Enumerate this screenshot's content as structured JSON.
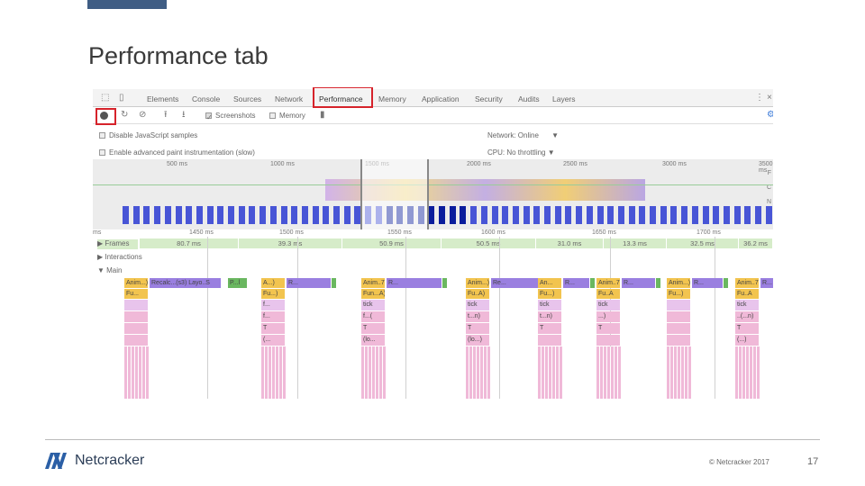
{
  "slide": {
    "title": "Performance tab",
    "copyright": "© Netcracker 2017",
    "page_number": "17",
    "logo_text": "Netcracker",
    "accent": "#3f5d84",
    "highlight": "#d6232b"
  },
  "devtools": {
    "tabs": [
      "Elements",
      "Console",
      "Sources",
      "Network",
      "Performance",
      "Memory",
      "Application",
      "Security",
      "Audits",
      "Layers"
    ],
    "active_tab": "Performance",
    "toolbar": {
      "screenshots_label": "Screenshots",
      "screenshots_checked": true,
      "memory_label": "Memory",
      "memory_checked": false
    },
    "settings": {
      "disable_js_samples": "Disable JavaScript samples",
      "advanced_paint": "Enable advanced paint instrumentation (slow)",
      "network_label": "Network:",
      "network_value": "Online",
      "cpu_label": "CPU:",
      "cpu_value": "No throttling"
    },
    "overview_ticks": [
      "500 ms",
      "1000 ms",
      "1500 ms",
      "2000 ms",
      "2500 ms",
      "3000 ms",
      "3500 ms"
    ],
    "overview_side_labels": [
      "F",
      "C",
      "N"
    ],
    "timeline_ticks": [
      "ms",
      "1450 ms",
      "1500 ms",
      "1550 ms",
      "1600 ms",
      "1650 ms",
      "1700 ms"
    ],
    "tracks": {
      "frames": "Frames",
      "interactions": "Interactions",
      "main": "Main"
    },
    "frames": [
      "80.7 ms",
      "39.3 ms",
      "50.9 ms",
      "50.5 ms",
      "31.0 ms",
      "13.3 ms",
      "32.5 ms",
      "36.2 ms"
    ],
    "colors": {
      "scripting": "#f2c44f",
      "rendering": "#9a7fe0",
      "painting": "#6ab760",
      "js": "#f0b9d8",
      "frames": "#d6ecc9"
    },
    "flame_groups": [
      {
        "anim": "Anim...)",
        "recalc": "Recalc...(s3)  Layo..S",
        "paint": "P...l",
        "fn": "Fu...",
        "stack": [
          "",
          "",
          "",
          ""
        ]
      },
      {
        "anim": "A...)",
        "recalc": "R...",
        "fn": "Fu...)",
        "stack": [
          "f...",
          "f...",
          "T",
          "(..."
        ]
      },
      {
        "anim": "Anim..7)",
        "recalc": "R...",
        "fn": "Fun...A)",
        "stack": [
          "tick",
          "f...(",
          "T",
          "(lo..."
        ]
      },
      {
        "anim": "Anim...)",
        "recalc": "Re...",
        "fn": "Fu..A)",
        "stack": [
          "tick",
          "t...n)",
          "T",
          "(lo...)"
        ]
      },
      {
        "anim": "An...",
        "recalc": "R...",
        "fn": "Fu...)",
        "stack": [
          "tick",
          "t...n)",
          "T",
          ""
        ]
      },
      {
        "anim": "Anim..7)",
        "recalc": "R...",
        "fn": "Fu..A",
        "stack": [
          "tick",
          "...)",
          "T",
          ""
        ]
      },
      {
        "anim": "Anim...)",
        "recalc": "R...",
        "fn": "Fu...)",
        "stack": [
          "",
          "",
          "",
          ""
        ]
      },
      {
        "anim": "Anim..7)",
        "recalc": "R...",
        "fn": "Fu..A",
        "stack": [
          "tick",
          "..(...n)",
          "T",
          "(...)"
        ]
      }
    ]
  }
}
